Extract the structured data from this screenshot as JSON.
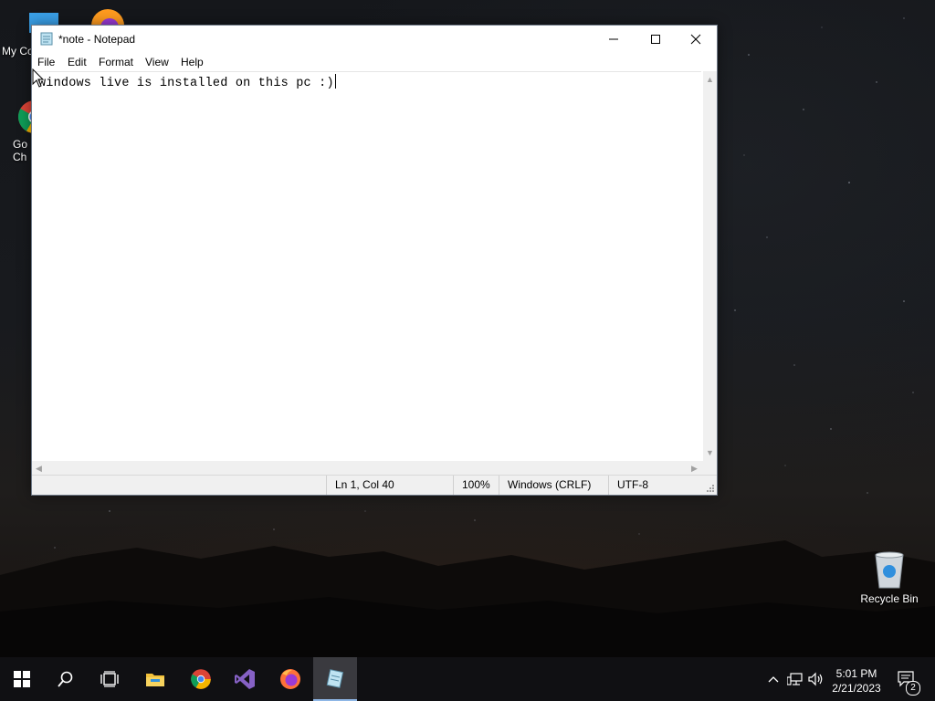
{
  "desktop": {
    "icons": [
      {
        "label": "My Co"
      },
      {
        "label": "Go Ch"
      },
      {
        "label": "Recycle Bin"
      }
    ]
  },
  "notepad": {
    "title": "*note - Notepad",
    "menu": [
      "File",
      "Edit",
      "Format",
      "View",
      "Help"
    ],
    "content": "windows live is installed on this pc :)",
    "status": {
      "position": "Ln 1, Col 40",
      "zoom": "100%",
      "line_ending": "Windows (CRLF)",
      "encoding": "UTF-8"
    }
  },
  "taskbar": {
    "pinned": [
      "windows-start-icon",
      "search-icon",
      "task-view-icon",
      "file-explorer-icon",
      "chrome-icon",
      "visual-studio-icon",
      "firefox-icon",
      "notepad-icon"
    ],
    "clock": {
      "time": "5:01 PM",
      "date": "2/21/2023"
    },
    "notification_count": "2"
  },
  "colors": {
    "taskbar": "#101013",
    "active_indicator": "#8fb7e6",
    "vs_purple": "#8661c5"
  }
}
